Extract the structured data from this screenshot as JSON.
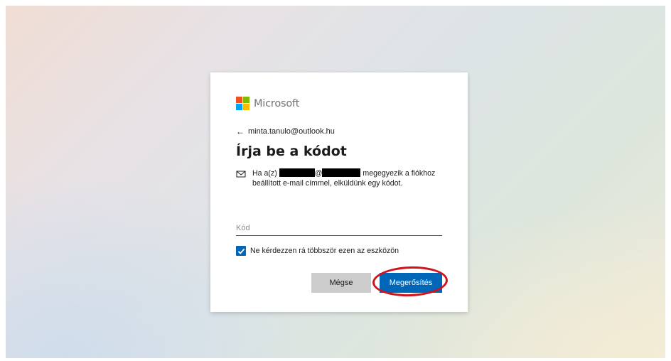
{
  "logo": {
    "text": "Microsoft",
    "colors": [
      "#f25022",
      "#7fba00",
      "#00a4ef",
      "#ffb900"
    ],
    "icon": "microsoft-logo-icon"
  },
  "identity": {
    "back_icon": "back-arrow-icon",
    "back_glyph": "←",
    "email": "minta.tanulo@outlook.hu"
  },
  "title": "Írja be a kódot",
  "info": {
    "icon": "mail-icon",
    "prefix": "Ha a(z)",
    "at": "@",
    "suffix": "megegyezik a fiókhoz beállított e-mail címmel, elküldünk egy kódot."
  },
  "code_field": {
    "placeholder": "Kód",
    "value": ""
  },
  "remember": {
    "checked": true,
    "label": "Ne kérdezzen rá többször ezen az eszközön"
  },
  "buttons": {
    "cancel_label": "Mégse",
    "confirm_label": "Megerősítés"
  },
  "colors": {
    "accent": "#0067b8",
    "highlight": "#d0121b",
    "cancel_bg": "#cccccc"
  }
}
